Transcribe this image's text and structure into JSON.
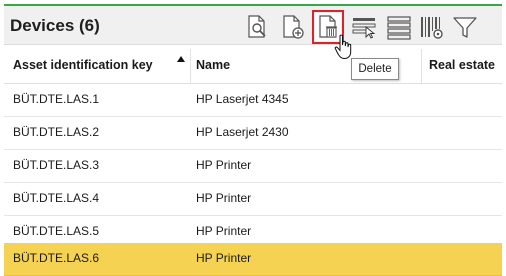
{
  "panel": {
    "title": "Devices (6)"
  },
  "toolbar": {
    "tooltip": "Delete"
  },
  "table": {
    "columns": [
      "Asset identification key",
      "Name",
      "Real estate"
    ],
    "rows": [
      {
        "key": "BÜT.DTE.LAS.1",
        "name": "HP Laserjet 4345"
      },
      {
        "key": "BÜT.DTE.LAS.2",
        "name": "HP Laserjet 2430"
      },
      {
        "key": "BÜT.DTE.LAS.3",
        "name": "HP Printer"
      },
      {
        "key": "BÜT.DTE.LAS.4",
        "name": "HP Printer"
      },
      {
        "key": "BÜT.DTE.LAS.5",
        "name": "HP Printer"
      },
      {
        "key": "BÜT.DTE.LAS.6",
        "name": "HP Printer"
      }
    ],
    "selected_row": 6
  },
  "colors": {
    "accent": "#3aa64a",
    "selection": "#f5d251",
    "highlight": "#d9232d"
  },
  "icons": [
    "view-document-icon",
    "add-document-icon",
    "delete-document-icon",
    "select-rows-icon",
    "list-view-icon",
    "barcode-settings-icon",
    "filter-icon"
  ]
}
